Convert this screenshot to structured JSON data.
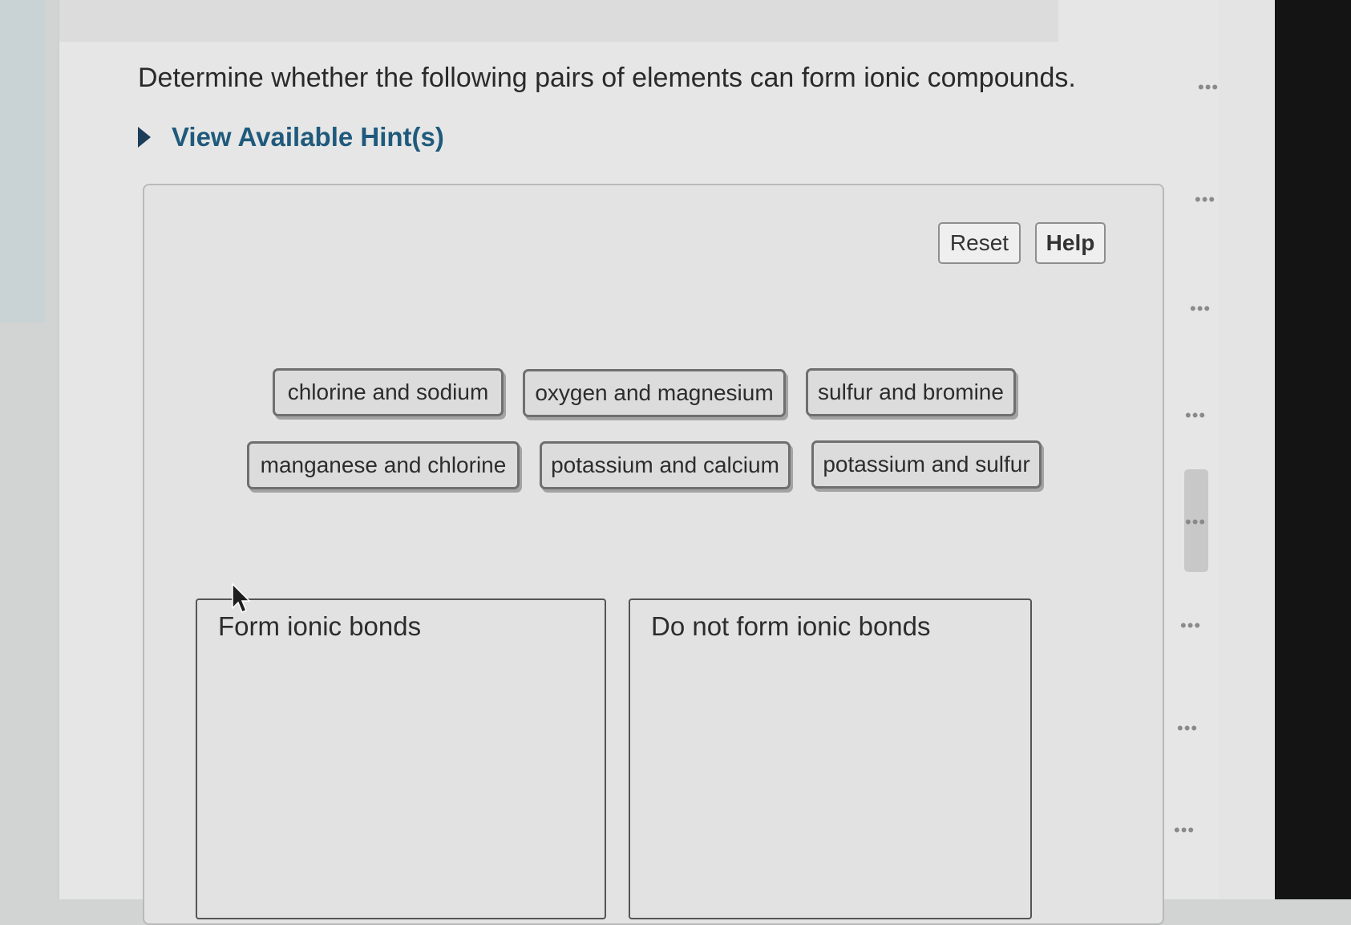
{
  "question": {
    "text": "Determine whether the following pairs of elements can form ionic compounds."
  },
  "hint": {
    "label": "View Available Hint(s)"
  },
  "toolbar": {
    "reset_label": "Reset",
    "help_label": "Help"
  },
  "tokens": [
    "chlorine and sodium",
    "oxygen and magnesium",
    "sulfur and bromine",
    "manganese and chlorine",
    "potassium and calcium",
    "potassium and sulfur"
  ],
  "bins": {
    "form": "Form ionic bonds",
    "not_form": "Do not form ionic bonds"
  },
  "side_markers": [
    "•••",
    "•••",
    "•••",
    "•••",
    "•••",
    "•••",
    "•••",
    "•••"
  ],
  "colors": {
    "hint_text": "#1f5a7c",
    "token_fill": "#dcdcdc",
    "token_border": "#6f6f6f",
    "page_background": "#e6e6e6"
  }
}
